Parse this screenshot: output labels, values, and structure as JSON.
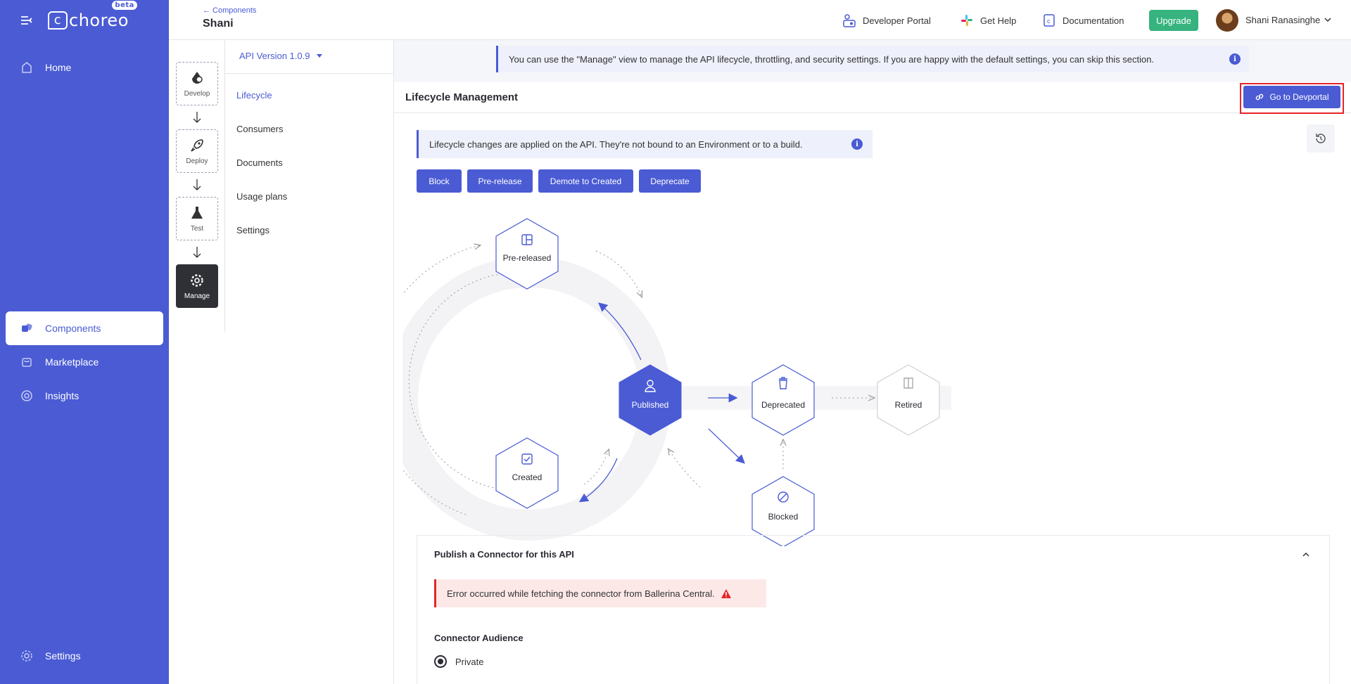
{
  "brand": {
    "name": "choreo",
    "badge": "beta"
  },
  "leftnav": {
    "items": [
      {
        "label": "Home",
        "icon": "home-icon"
      },
      {
        "label": "Components",
        "icon": "components-icon",
        "active": true
      },
      {
        "label": "Marketplace",
        "icon": "marketplace-icon"
      },
      {
        "label": "Insights",
        "icon": "insights-icon"
      }
    ],
    "settings": {
      "label": "Settings",
      "icon": "gear-icon"
    }
  },
  "header": {
    "breadcrumb": "← Components",
    "title": "Shani",
    "links": [
      {
        "label": "Developer Portal",
        "icon": "developer-portal-icon"
      },
      {
        "label": "Get Help",
        "icon": "slack-icon"
      },
      {
        "label": "Documentation",
        "icon": "documentation-icon"
      }
    ],
    "upgrade": "Upgrade",
    "user": "Shani Ranasinghe"
  },
  "steps": [
    {
      "label": "Develop",
      "icon": "develop-icon"
    },
    {
      "label": "Deploy",
      "icon": "rocket-icon"
    },
    {
      "label": "Test",
      "icon": "flask-icon"
    },
    {
      "label": "Manage",
      "icon": "gear-icon",
      "active": true
    }
  ],
  "submenu": {
    "version": "API Version 1.0.9",
    "items": [
      {
        "label": "Lifecycle",
        "active": true
      },
      {
        "label": "Consumers"
      },
      {
        "label": "Documents"
      },
      {
        "label": "Usage plans"
      },
      {
        "label": "Settings"
      }
    ]
  },
  "main": {
    "banner": "You can use the \"Manage\" view to manage the API lifecycle, throttling, and security settings. If you are happy with the default settings, you can skip this section.",
    "section_title": "Lifecycle Management",
    "devportal_button": "Go to Devportal",
    "lifecycle_note": "Lifecycle changes are applied on the API. They're not bound to an Environment or to a build.",
    "actions": [
      "Block",
      "Pre-release",
      "Demote to Created",
      "Deprecate"
    ],
    "states": {
      "prereleased": "Pre-released",
      "published": "Published",
      "created": "Created",
      "deprecated": "Deprecated",
      "blocked": "Blocked",
      "retired": "Retired"
    },
    "connector": {
      "title": "Publish a Connector for this API",
      "error": "Error occurred while fetching the connector from Ballerina Central.",
      "audience_title": "Connector Audience",
      "option_private": "Private"
    }
  },
  "colors": {
    "accent": "#4a5bd4",
    "success": "#36b37e",
    "error": "#e5242a"
  }
}
